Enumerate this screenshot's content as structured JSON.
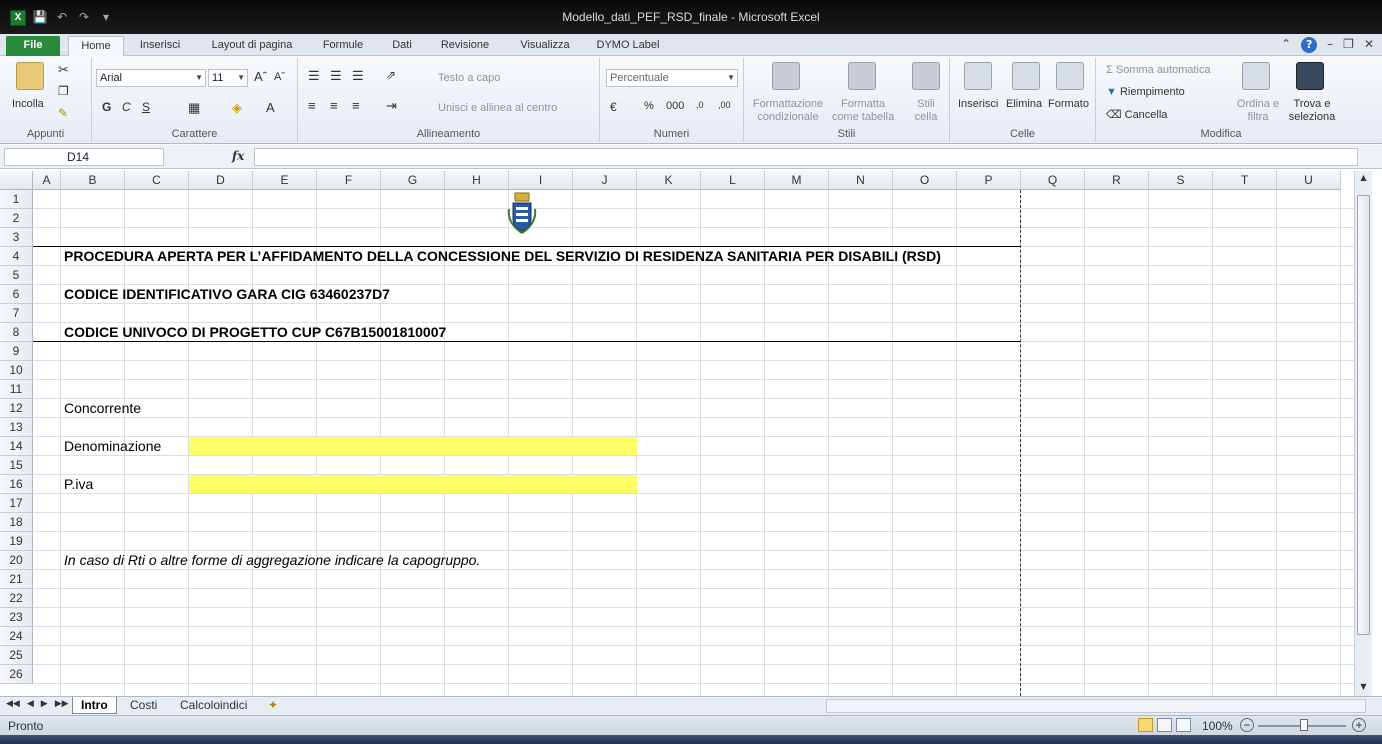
{
  "window": {
    "title": "Modello_dati_PEF_RSD_finale - Microsoft Excel",
    "app_icon": "X"
  },
  "tabs": [
    "File",
    "Home",
    "Inserisci",
    "Layout di pagina",
    "Formule",
    "Dati",
    "Revisione",
    "Visualizza",
    "DYMO Label"
  ],
  "active_tab": "Home",
  "ribbon": {
    "clipboard": {
      "paste": "Incolla",
      "group": "Appunti"
    },
    "font": {
      "name": "Arial",
      "size": "11",
      "bold": "G",
      "italic": "C",
      "underline": "S",
      "group": "Carattere"
    },
    "alignment": {
      "wrap": "Testo a capo",
      "merge": "Unisci e allinea al centro",
      "group": "Allineamento"
    },
    "number": {
      "format": "Percentuale",
      "percent": "%",
      "thousands": "000",
      "group": "Numeri"
    },
    "styles": {
      "conditional": "Formattazione condizionale",
      "table": "Formatta come tabella",
      "cell": "Stili cella",
      "group": "Stili"
    },
    "cells": {
      "insert": "Inserisci",
      "delete": "Elimina",
      "format": "Formato",
      "group": "Celle"
    },
    "editing": {
      "autosum": "Somma automatica",
      "fill": "Riempimento",
      "clear": "Cancella",
      "sort": "Ordina e filtra",
      "find": "Trova e seleziona",
      "group": "Modifica"
    }
  },
  "formula_bar": {
    "name_box": "D14",
    "fx": "fx",
    "value": ""
  },
  "columns": [
    "A",
    "B",
    "C",
    "D",
    "E",
    "F",
    "G",
    "H",
    "I",
    "J",
    "K",
    "L",
    "M",
    "N",
    "O",
    "P",
    "Q",
    "R",
    "S",
    "T",
    "U"
  ],
  "rows": [
    "1",
    "2",
    "3",
    "4",
    "5",
    "6",
    "7",
    "8",
    "9",
    "10",
    "11",
    "12",
    "13",
    "14",
    "15",
    "16",
    "17",
    "18",
    "19",
    "20",
    "21",
    "22",
    "23",
    "24",
    "25",
    "26"
  ],
  "cells": {
    "title": "PROCEDURA APERTA PER L’AFFIDAMENTO DELLA CONCESSIONE DEL SERVIZIO DI RESIDENZA SANITARIA PER DISABILI (RSD)",
    "cig": "CODICE IDENTIFICATIVO GARA CIG 63460237D7",
    "cup": "CODICE UNIVOCO DI PROGETTO CUP C67B15001810007",
    "concorrente": "Concorrente",
    "denominazione": "Denominazione",
    "piva": "P.iva",
    "note": "In caso di Rti o altre forme di aggregazione indicare la capogruppo."
  },
  "sheets": [
    "Intro",
    "Costi",
    "Calcoloindici"
  ],
  "active_sheet": "Intro",
  "status": {
    "ready": "Pronto",
    "zoom": "100%"
  },
  "colors": {
    "input_fill": "#ffff66",
    "file_tab": "#2a8a3c"
  }
}
